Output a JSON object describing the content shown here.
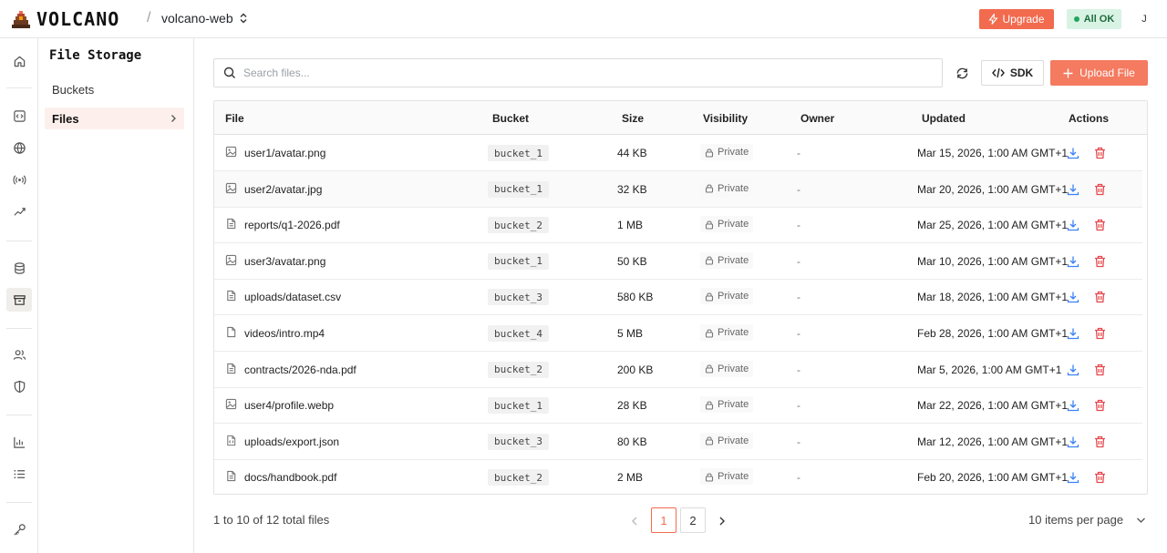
{
  "brand": {
    "name": "VOLCANO"
  },
  "header": {
    "separator": "/",
    "project": "volcano-web",
    "upgrade_label": "Upgrade",
    "status_label": "All OK",
    "user_initial": "J"
  },
  "rail": {
    "icons": [
      "home-icon",
      "code-icon",
      "globe-icon",
      "broadcast-icon",
      "shuffle-icon",
      "database-icon",
      "archive-icon",
      "users-icon",
      "shield-icon",
      "chart-icon",
      "list-icon",
      "key-icon"
    ],
    "active": "archive-icon"
  },
  "subnav": {
    "title": "File Storage",
    "items": [
      {
        "label": "Buckets",
        "active": false
      },
      {
        "label": "Files",
        "active": true
      }
    ]
  },
  "toolbar": {
    "search_placeholder": "Search files...",
    "search_value": "",
    "sdk_label": "SDK",
    "upload_label": "Upload File"
  },
  "table": {
    "columns": [
      "File",
      "Bucket",
      "Size",
      "Visibility",
      "Owner",
      "Updated",
      "Actions"
    ],
    "rows": [
      {
        "file": "user1/avatar.png",
        "type": "image",
        "bucket": "bucket_1",
        "size": "44 KB",
        "visibility": "Private",
        "owner": "-",
        "updated": "Mar 15, 2026, 1:00 AM GMT+1"
      },
      {
        "file": "user2/avatar.jpg",
        "type": "image",
        "bucket": "bucket_1",
        "size": "32 KB",
        "visibility": "Private",
        "owner": "-",
        "updated": "Mar 20, 2026, 1:00 AM GMT+1"
      },
      {
        "file": "reports/q1-2026.pdf",
        "type": "doc",
        "bucket": "bucket_2",
        "size": "1 MB",
        "visibility": "Private",
        "owner": "-",
        "updated": "Mar 25, 2026, 1:00 AM GMT+1"
      },
      {
        "file": "user3/avatar.png",
        "type": "image",
        "bucket": "bucket_1",
        "size": "50 KB",
        "visibility": "Private",
        "owner": "-",
        "updated": "Mar 10, 2026, 1:00 AM GMT+1"
      },
      {
        "file": "uploads/dataset.csv",
        "type": "doc",
        "bucket": "bucket_3",
        "size": "580 KB",
        "visibility": "Private",
        "owner": "-",
        "updated": "Mar 18, 2026, 1:00 AM GMT+1"
      },
      {
        "file": "videos/intro.mp4",
        "type": "file",
        "bucket": "bucket_4",
        "size": "5 MB",
        "visibility": "Private",
        "owner": "-",
        "updated": "Feb 28, 2026, 1:00 AM GMT+1"
      },
      {
        "file": "contracts/2026-nda.pdf",
        "type": "doc",
        "bucket": "bucket_2",
        "size": "200 KB",
        "visibility": "Private",
        "owner": "-",
        "updated": "Mar 5, 2026, 1:00 AM GMT+1"
      },
      {
        "file": "user4/profile.webp",
        "type": "image",
        "bucket": "bucket_1",
        "size": "28 KB",
        "visibility": "Private",
        "owner": "-",
        "updated": "Mar 22, 2026, 1:00 AM GMT+1"
      },
      {
        "file": "uploads/export.json",
        "type": "code",
        "bucket": "bucket_3",
        "size": "80 KB",
        "visibility": "Private",
        "owner": "-",
        "updated": "Mar 12, 2026, 1:00 AM GMT+1"
      },
      {
        "file": "docs/handbook.pdf",
        "type": "doc",
        "bucket": "bucket_2",
        "size": "2 MB",
        "visibility": "Private",
        "owner": "-",
        "updated": "Feb 20, 2026, 1:00 AM GMT+1"
      }
    ]
  },
  "pagination": {
    "summary": "1 to 10 of 12 total files",
    "pages": [
      "1",
      "2"
    ],
    "current": "1",
    "per_page_label": "10 items per page"
  },
  "colors": {
    "accent": "#f26b4f",
    "status_bg": "#d8f3e4",
    "download": "#3b82f6",
    "delete": "#e5484d"
  }
}
